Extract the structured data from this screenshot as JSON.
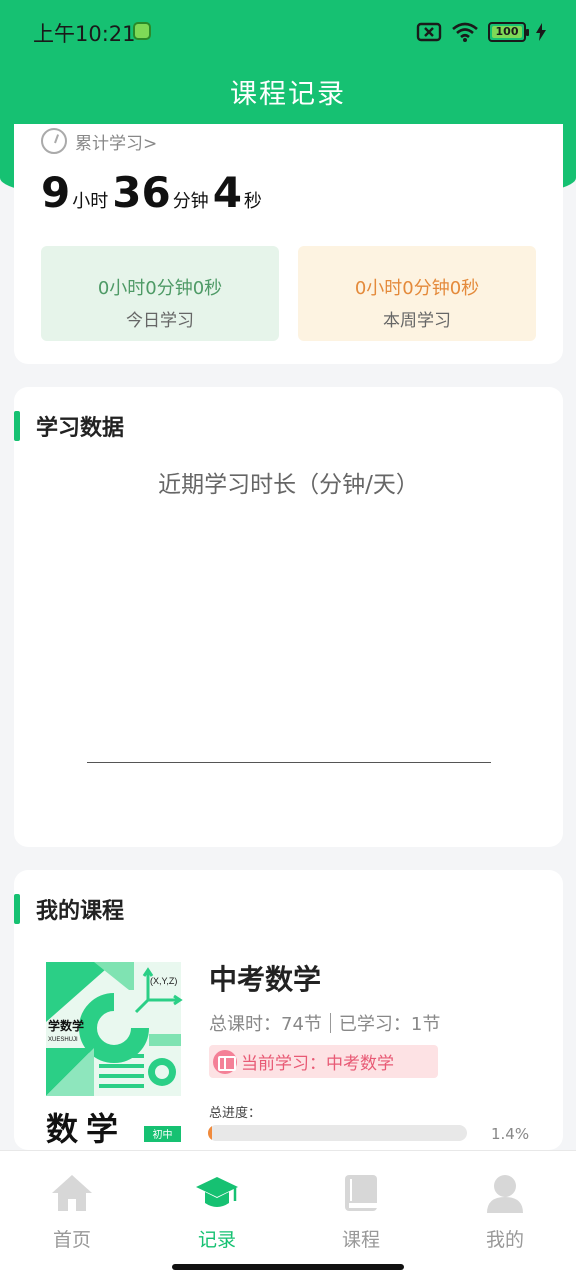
{
  "status_bar": {
    "time": "上午10:21",
    "battery": "100",
    "icons": [
      "notification-app-icon",
      "sim-off-icon",
      "wifi-icon",
      "battery-icon",
      "charging-icon"
    ]
  },
  "header": {
    "title": "课程记录"
  },
  "summary": {
    "total_label": "累计学习>",
    "hours": "9",
    "hours_unit": "小时",
    "minutes": "36",
    "minutes_unit": "分钟",
    "seconds": "4",
    "seconds_unit": "秒",
    "today": {
      "value": "0小时0分钟0秒",
      "label": "今日学习"
    },
    "week": {
      "value": "0小时0分钟0秒",
      "label": "本周学习"
    }
  },
  "study_data": {
    "section_title": "学习数据",
    "chart_title": "近期学习时长（分钟/天）"
  },
  "my_courses": {
    "section_title": "我的课程",
    "course": {
      "cover_title": "数学",
      "cover_badge": "初中",
      "cover_brand": "学数学",
      "cover_brand_sub": "XUESHUJI",
      "cover_formula": "(X,Y,Z)",
      "name": "中考数学",
      "total": "总课时：74节",
      "learned": "已学习：1节",
      "current": "当前学习：中考数学",
      "progress_label": "总进度：",
      "progress_fraction": 0.014,
      "progress_text": "1.4%"
    }
  },
  "tabs": [
    {
      "label": "首页",
      "icon": "home-icon"
    },
    {
      "label": "记录",
      "icon": "graduation-cap-icon"
    },
    {
      "label": "课程",
      "icon": "book-icon"
    },
    {
      "label": "我的",
      "icon": "profile-icon"
    }
  ],
  "colors": {
    "brand": "#16c172",
    "accent_orange": "#f08a3c",
    "accent_pink": "#e85a75"
  }
}
